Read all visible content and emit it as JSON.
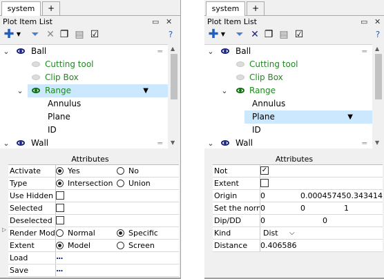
{
  "left": {
    "tabs": [
      "system",
      "+"
    ],
    "panel_title": "Plot Item List",
    "panel_controls": [
      "▭",
      "✕"
    ],
    "toolbar_help": "?",
    "tree": [
      {
        "label": "Ball",
        "color": "black",
        "level": 0,
        "expanded": true,
        "icon": "eye-icon"
      },
      {
        "label": "Cutting tool",
        "color": "green",
        "level": 1,
        "icon": "hidden-eye-icon"
      },
      {
        "label": "Clip Box",
        "color": "green",
        "level": 1,
        "icon": "hidden-eye-icon"
      },
      {
        "label": "Range",
        "color": "green",
        "level": 1,
        "expanded": true,
        "selected": true,
        "icon": "eye-icon"
      },
      {
        "label": "Annulus",
        "color": "black",
        "level": 2
      },
      {
        "label": "Plane",
        "color": "black",
        "level": 2
      },
      {
        "label": "ID",
        "color": "black",
        "level": 2
      },
      {
        "label": "Wall",
        "color": "black",
        "level": 0,
        "expanded": true,
        "icon": "eye-icon"
      }
    ],
    "attributes_title": "Attributes",
    "attributes": [
      {
        "name": "Activate",
        "type": "radio",
        "options": [
          "Yes",
          "No"
        ],
        "selected": 0
      },
      {
        "name": "Type",
        "type": "radio",
        "options": [
          "Intersection",
          "Union"
        ],
        "selected": 0
      },
      {
        "name": "Use Hidden",
        "type": "checkbox",
        "checked": false
      },
      {
        "name": "Selected",
        "type": "checkbox",
        "checked": false
      },
      {
        "name": "Deselected",
        "type": "checkbox",
        "checked": false
      },
      {
        "name": "Render Mode",
        "type": "radio",
        "options": [
          "Normal",
          "Specific"
        ],
        "selected": 1
      },
      {
        "name": "Extent",
        "type": "radio",
        "options": [
          "Model",
          "Screen"
        ],
        "selected": 0
      },
      {
        "name": "Load",
        "type": "button",
        "value": "..."
      },
      {
        "name": "Save",
        "type": "button",
        "value": "..."
      }
    ]
  },
  "right": {
    "tabs": [
      "system",
      "+"
    ],
    "panel_title": "Plot Item List",
    "panel_controls": [
      "▭",
      "✕"
    ],
    "toolbar_help": "?",
    "tree": [
      {
        "label": "Ball",
        "color": "black",
        "level": 0,
        "expanded": true,
        "icon": "eye-icon"
      },
      {
        "label": "Cutting tool",
        "color": "green",
        "level": 1,
        "icon": "hidden-eye-icon"
      },
      {
        "label": "Clip Box",
        "color": "green",
        "level": 1,
        "icon": "hidden-eye-icon"
      },
      {
        "label": "Range",
        "color": "green",
        "level": 1,
        "expanded": true,
        "icon": "eye-icon"
      },
      {
        "label": "Annulus",
        "color": "black",
        "level": 2
      },
      {
        "label": "Plane",
        "color": "black",
        "level": 2,
        "selected": true
      },
      {
        "label": "ID",
        "color": "black",
        "level": 2
      },
      {
        "label": "Wall",
        "color": "black",
        "level": 0,
        "expanded": true,
        "icon": "eye-icon"
      }
    ],
    "attributes_title": "Attributes",
    "attributes": [
      {
        "name": "Not",
        "type": "checkbox",
        "checked": true
      },
      {
        "name": "Extent",
        "type": "checkbox",
        "checked": false
      },
      {
        "name": "Origin",
        "type": "triple",
        "values": [
          "0",
          "0.000457450.343414",
          ""
        ]
      },
      {
        "name": "Set the norma",
        "type": "triple",
        "values": [
          "0",
          "0",
          "1"
        ]
      },
      {
        "name": "Dip/DD",
        "type": "triple",
        "values": [
          "0",
          "0",
          ""
        ]
      },
      {
        "name": "Kind",
        "type": "select",
        "value": "Dist"
      },
      {
        "name": "Distance",
        "type": "text",
        "value": "0.406586"
      }
    ]
  },
  "colors": {
    "selection": "#cce8ff",
    "green_text": "#1e8a1e",
    "eye": "#1a237e",
    "toolbar_blue": "#1f5fbf"
  }
}
